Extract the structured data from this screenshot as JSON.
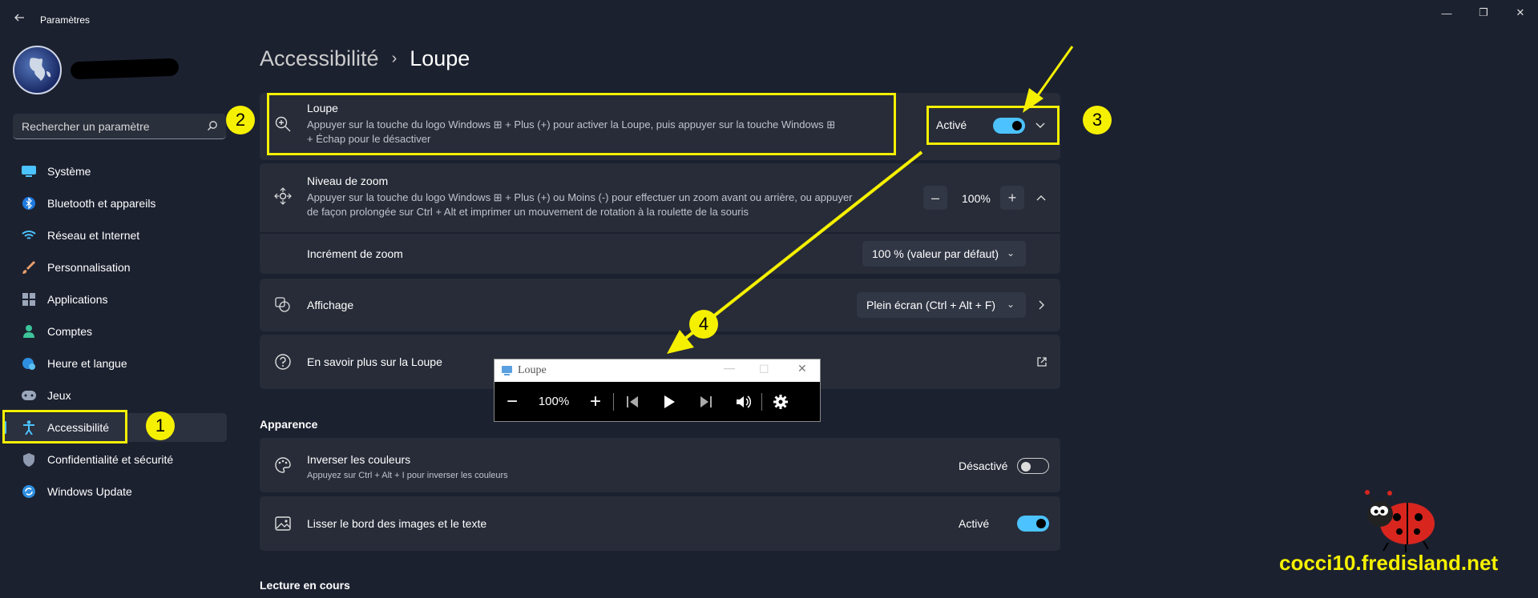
{
  "app": {
    "title": "Paramètres"
  },
  "search": {
    "placeholder": "Rechercher un paramètre"
  },
  "sidebar": {
    "items": [
      {
        "label": "Système",
        "icon": "monitor-icon"
      },
      {
        "label": "Bluetooth et appareils",
        "icon": "bluetooth-icon"
      },
      {
        "label": "Réseau et Internet",
        "icon": "wifi-icon"
      },
      {
        "label": "Personnalisation",
        "icon": "brush-icon"
      },
      {
        "label": "Applications",
        "icon": "apps-icon"
      },
      {
        "label": "Comptes",
        "icon": "person-icon"
      },
      {
        "label": "Heure et langue",
        "icon": "globe-clock-icon"
      },
      {
        "label": "Jeux",
        "icon": "gamepad-icon"
      },
      {
        "label": "Accessibilité",
        "icon": "accessibility-icon",
        "selected": true
      },
      {
        "label": "Confidentialité et sécurité",
        "icon": "shield-icon"
      },
      {
        "label": "Windows Update",
        "icon": "update-icon"
      }
    ]
  },
  "breadcrumb": {
    "parent": "Accessibilité",
    "separator": "›",
    "current": "Loupe"
  },
  "loupe": {
    "title": "Loupe",
    "desc_line1": "Appuyer sur la touche du logo Windows ⊞ + Plus (+) pour activer la Loupe, puis appuyer sur la touche Windows ⊞",
    "desc_line2": "+ Échap pour le désactiver",
    "state": "Activé",
    "enabled": true
  },
  "zoom": {
    "title": "Niveau de zoom",
    "desc_line1": "Appuyer sur la touche du logo Windows ⊞ + Plus (+) ou Moins (-) pour effectuer un zoom avant ou arrière, ou appuyer",
    "desc_line2": "de façon prolongée sur Ctrl + Alt et imprimer un mouvement de rotation à la roulette de la souris",
    "minus": "–",
    "value": "100%",
    "plus": "+"
  },
  "increment": {
    "label": "Incrément de zoom",
    "value": "100 % (valeur par défaut)"
  },
  "display": {
    "label": "Affichage",
    "value": "Plein écran (Ctrl + Alt + F)"
  },
  "learn": {
    "label": "En savoir plus sur la Loupe"
  },
  "appearance": {
    "section": "Apparence",
    "invert": {
      "title": "Inverser les couleurs",
      "desc": "Appuyez sur Ctrl + Alt + I pour inverser les couleurs",
      "state": "Désactivé",
      "enabled": false
    },
    "smooth": {
      "title": "Lisser le bord des images et le texte",
      "state": "Activé",
      "enabled": true
    }
  },
  "reading": {
    "section": "Lecture en cours"
  },
  "magnifier_window": {
    "title": "Loupe",
    "zoom": "100%"
  },
  "annotations": {
    "n1": "1",
    "n2": "2",
    "n3": "3",
    "n4": "4"
  },
  "watermark": "cocci10.fredisland.net",
  "colors": {
    "background": "#1c2130",
    "card": "#272c38",
    "accent": "#4cc2ff",
    "highlight": "#f5f000"
  }
}
